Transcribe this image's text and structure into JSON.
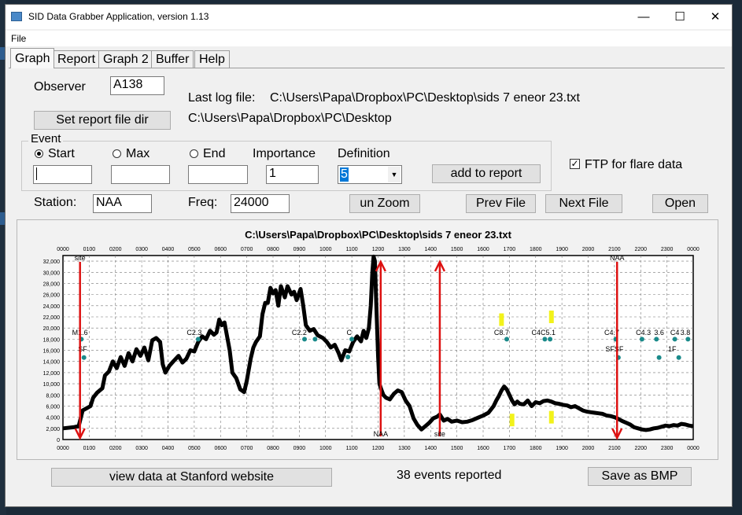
{
  "window": {
    "title": "SID Data Grabber Application, version 1.13",
    "minimize": "—",
    "maximize": "☐",
    "close": "✕"
  },
  "menu": {
    "file": "File"
  },
  "tabs": [
    {
      "label": "Graph"
    },
    {
      "label": "Report"
    },
    {
      "label": "Graph 2"
    },
    {
      "label": "Buffer"
    },
    {
      "label": "Help"
    }
  ],
  "observer": {
    "label": "Observer",
    "value": "A138"
  },
  "log": {
    "label": "Last log file:",
    "path": "C:\\Users\\Papa\\Dropbox\\PC\\Desktop\\sids 7 eneor 23.txt",
    "report_dir": "C:\\Users\\Papa\\Dropbox\\PC\\Desktop"
  },
  "buttons": {
    "set_report_dir": "Set report file dir",
    "add_to_report": "add to report",
    "unzoom": "un Zoom",
    "prev_file": "Prev File",
    "next_file": "Next File",
    "open": "Open",
    "view_stanford": "view data at Stanford website",
    "save_bmp": "Save as BMP"
  },
  "event": {
    "group_label": "Event",
    "start_label": "Start",
    "max_label": "Max",
    "end_label": "End",
    "importance_label": "Importance",
    "importance_value": "1",
    "definition_label": "Definition",
    "definition_value": "5"
  },
  "ftp": {
    "label": "FTP for flare data",
    "checked": true
  },
  "station": {
    "label": "Station:",
    "value": "NAA"
  },
  "freq": {
    "label": "Freq:",
    "value": "24000"
  },
  "status": {
    "events_reported": "38 events reported"
  },
  "colors": {
    "signal": "#000000",
    "marker_arrow": "#dd1111",
    "flare_dot": "#1a8a8a",
    "flare_bar": "#f2f21a",
    "accent": "#0078d7"
  },
  "chart_data": {
    "type": "line",
    "title": "C:\\Users\\Papa\\Dropbox\\PC\\Desktop\\sids 7 eneor 23.txt",
    "x_ticks": [
      "0000",
      "0100",
      "0200",
      "0300",
      "0400",
      "0500",
      "0600",
      "0700",
      "0800",
      "0900",
      "1000",
      "1100",
      "1200",
      "1300",
      "1400",
      "1500",
      "1600",
      "1700",
      "1800",
      "1900",
      "2000",
      "2100",
      "2200",
      "2300",
      "0000"
    ],
    "ylim": [
      0,
      33000
    ],
    "y_ticks": [
      "0",
      "2,000",
      "4,000",
      "6,000",
      "8,000",
      "10,000",
      "12,000",
      "14,000",
      "16,000",
      "18,000",
      "20,000",
      "22,000",
      "24,000",
      "26,000",
      "28,000",
      "30,000",
      "32,000"
    ],
    "grid": true,
    "signal_series": [
      [
        0.0,
        2000
      ],
      [
        0.4,
        2200
      ],
      [
        0.6,
        2400
      ],
      [
        0.75,
        5200
      ],
      [
        0.9,
        5600
      ],
      [
        1.05,
        6000
      ],
      [
        1.15,
        7500
      ],
      [
        1.3,
        8400
      ],
      [
        1.5,
        9200
      ],
      [
        1.6,
        11500
      ],
      [
        1.75,
        12200
      ],
      [
        1.9,
        14000
      ],
      [
        2.05,
        12800
      ],
      [
        2.2,
        14800
      ],
      [
        2.35,
        13200
      ],
      [
        2.5,
        15500
      ],
      [
        2.65,
        14000
      ],
      [
        2.8,
        16200
      ],
      [
        2.95,
        15000
      ],
      [
        3.1,
        16500
      ],
      [
        3.25,
        14200
      ],
      [
        3.4,
        17800
      ],
      [
        3.55,
        18200
      ],
      [
        3.7,
        17500
      ],
      [
        3.8,
        13500
      ],
      [
        3.9,
        12000
      ],
      [
        4.05,
        13200
      ],
      [
        4.2,
        14000
      ],
      [
        4.4,
        15000
      ],
      [
        4.55,
        13800
      ],
      [
        4.7,
        14500
      ],
      [
        4.85,
        16000
      ],
      [
        5.0,
        15800
      ],
      [
        5.15,
        17500
      ],
      [
        5.3,
        18500
      ],
      [
        5.45,
        18000
      ],
      [
        5.6,
        19500
      ],
      [
        5.75,
        18800
      ],
      [
        5.85,
        19200
      ],
      [
        5.95,
        21500
      ],
      [
        6.05,
        20500
      ],
      [
        6.15,
        21000
      ],
      [
        6.25,
        18500
      ],
      [
        6.35,
        16000
      ],
      [
        6.45,
        12000
      ],
      [
        6.6,
        11000
      ],
      [
        6.75,
        9000
      ],
      [
        6.9,
        8500
      ],
      [
        7.0,
        10500
      ],
      [
        7.15,
        14500
      ],
      [
        7.25,
        16500
      ],
      [
        7.35,
        17500
      ],
      [
        7.5,
        18500
      ],
      [
        7.6,
        22500
      ],
      [
        7.7,
        24500
      ],
      [
        7.8,
        24500
      ],
      [
        7.9,
        27200
      ],
      [
        8.0,
        26200
      ],
      [
        8.1,
        26800
      ],
      [
        8.2,
        24000
      ],
      [
        8.3,
        27500
      ],
      [
        8.45,
        25500
      ],
      [
        8.55,
        27500
      ],
      [
        8.7,
        26000
      ],
      [
        8.8,
        26500
      ],
      [
        8.9,
        25000
      ],
      [
        9.05,
        27000
      ],
      [
        9.15,
        24000
      ],
      [
        9.25,
        20500
      ],
      [
        9.4,
        19500
      ],
      [
        9.55,
        19800
      ],
      [
        9.7,
        18700
      ],
      [
        9.9,
        18200
      ],
      [
        10.05,
        17500
      ],
      [
        10.2,
        16500
      ],
      [
        10.35,
        17000
      ],
      [
        10.5,
        15500
      ],
      [
        10.6,
        14200
      ],
      [
        10.75,
        16000
      ],
      [
        10.9,
        15800
      ],
      [
        11.05,
        17500
      ],
      [
        11.2,
        18500
      ],
      [
        11.35,
        17600
      ],
      [
        11.45,
        19500
      ],
      [
        11.55,
        18200
      ],
      [
        11.65,
        20000
      ],
      [
        11.72,
        24000
      ],
      [
        11.78,
        30000
      ],
      [
        11.83,
        32800
      ],
      [
        11.88,
        32000
      ],
      [
        11.92,
        26000
      ],
      [
        12.0,
        15000
      ],
      [
        12.05,
        10000
      ],
      [
        12.12,
        9000
      ],
      [
        12.2,
        8000
      ],
      [
        12.3,
        7500
      ],
      [
        12.45,
        7200
      ],
      [
        12.6,
        8200
      ],
      [
        12.75,
        8800
      ],
      [
        12.9,
        8500
      ],
      [
        13.05,
        7000
      ],
      [
        13.2,
        6000
      ],
      [
        13.35,
        3800
      ],
      [
        13.5,
        2600
      ],
      [
        13.65,
        1800
      ],
      [
        13.8,
        2400
      ],
      [
        13.95,
        3000
      ],
      [
        14.1,
        3800
      ],
      [
        14.25,
        4100
      ],
      [
        14.35,
        4500
      ],
      [
        14.5,
        3400
      ],
      [
        14.65,
        3700
      ],
      [
        14.8,
        3200
      ],
      [
        15.0,
        3400
      ],
      [
        15.2,
        3100
      ],
      [
        15.4,
        3200
      ],
      [
        15.6,
        3500
      ],
      [
        15.8,
        3900
      ],
      [
        16.0,
        4300
      ],
      [
        16.2,
        4800
      ],
      [
        16.4,
        6000
      ],
      [
        16.5,
        7000
      ],
      [
        16.6,
        7800
      ],
      [
        16.7,
        8800
      ],
      [
        16.8,
        9500
      ],
      [
        16.9,
        9000
      ],
      [
        17.0,
        8000
      ],
      [
        17.1,
        7000
      ],
      [
        17.2,
        6300
      ],
      [
        17.3,
        6800
      ],
      [
        17.4,
        6400
      ],
      [
        17.55,
        6300
      ],
      [
        17.7,
        7000
      ],
      [
        17.85,
        6000
      ],
      [
        18.0,
        6700
      ],
      [
        18.15,
        6500
      ],
      [
        18.3,
        6900
      ],
      [
        18.45,
        7000
      ],
      [
        18.6,
        6800
      ],
      [
        18.75,
        6500
      ],
      [
        18.9,
        6400
      ],
      [
        19.05,
        6200
      ],
      [
        19.2,
        6100
      ],
      [
        19.35,
        5800
      ],
      [
        19.5,
        6000
      ],
      [
        19.65,
        5600
      ],
      [
        19.8,
        5200
      ],
      [
        19.95,
        5000
      ],
      [
        20.1,
        4900
      ],
      [
        20.25,
        4800
      ],
      [
        20.4,
        4700
      ],
      [
        20.55,
        4600
      ],
      [
        20.7,
        4300
      ],
      [
        20.85,
        4200
      ],
      [
        21.0,
        4000
      ],
      [
        21.15,
        3700
      ],
      [
        21.3,
        3300
      ],
      [
        21.45,
        3000
      ],
      [
        21.6,
        2700
      ],
      [
        21.75,
        2200
      ],
      [
        21.9,
        2000
      ],
      [
        22.05,
        1800
      ],
      [
        22.2,
        1700
      ],
      [
        22.35,
        1800
      ],
      [
        22.5,
        2000
      ],
      [
        22.65,
        2100
      ],
      [
        22.8,
        2300
      ],
      [
        22.95,
        2500
      ],
      [
        23.1,
        2400
      ],
      [
        23.25,
        2600
      ],
      [
        23.4,
        2500
      ],
      [
        23.55,
        2800
      ],
      [
        23.7,
        2700
      ],
      [
        23.85,
        2500
      ],
      [
        24.0,
        2400
      ]
    ],
    "arrows": [
      {
        "x": 0.65,
        "direction": "down",
        "label": "site"
      },
      {
        "x": 12.1,
        "direction": "up",
        "label": "NAA"
      },
      {
        "x": 14.35,
        "direction": "up",
        "label": "site"
      },
      {
        "x": 21.1,
        "direction": "down",
        "label": "NAA"
      }
    ],
    "flare_labels": [
      {
        "text": "M1.6",
        "x": 0.65,
        "y": 18300
      },
      {
        "text": "SF",
        "x": 0.75,
        "y": 15400
      },
      {
        "text": "C2.3",
        "x": 5.0,
        "y": 18300
      },
      {
        "text": "C2.2",
        "x": 9.0,
        "y": 18300
      },
      {
        "text": "C",
        "x": 10.9,
        "y": 18300
      },
      {
        "text": "C8.7",
        "x": 16.7,
        "y": 18300
      },
      {
        "text": "C4C5.1",
        "x": 18.3,
        "y": 18300
      },
      {
        "text": "C4.7",
        "x": 20.9,
        "y": 18300
      },
      {
        "text": "SFSF",
        "x": 21.0,
        "y": 15400
      },
      {
        "text": "C4.3",
        "x": 22.1,
        "y": 18300
      },
      {
        "text": "3.6",
        "x": 22.7,
        "y": 18300
      },
      {
        "text": "C4",
        "x": 23.3,
        "y": 18300
      },
      {
        "text": "3.8",
        "x": 23.7,
        "y": 18300
      },
      {
        "text": "1F",
        "x": 23.2,
        "y": 15400
      }
    ],
    "flare_dots": [
      [
        0.7,
        18000
      ],
      [
        0.8,
        14700
      ],
      [
        5.15,
        18000
      ],
      [
        9.2,
        18000
      ],
      [
        9.6,
        18000
      ],
      [
        10.85,
        14800
      ],
      [
        11.0,
        18000
      ],
      [
        16.9,
        18000
      ],
      [
        18.35,
        18000
      ],
      [
        18.55,
        18000
      ],
      [
        21.05,
        18000
      ],
      [
        21.15,
        14700
      ],
      [
        22.05,
        18000
      ],
      [
        22.6,
        18000
      ],
      [
        22.7,
        14700
      ],
      [
        23.3,
        18000
      ],
      [
        23.45,
        14700
      ],
      [
        23.8,
        18000
      ]
    ],
    "flare_bars": [
      [
        16.7,
        21500
      ],
      [
        17.1,
        3500
      ],
      [
        18.6,
        22000
      ],
      [
        18.6,
        4000
      ]
    ]
  }
}
